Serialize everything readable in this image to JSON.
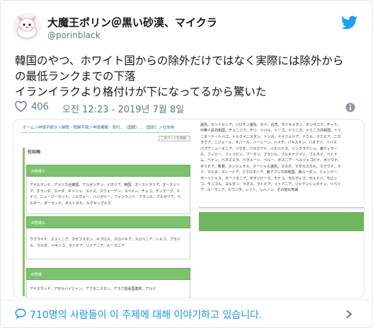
{
  "tweet": {
    "display_name": "大魔王ポリン＠黒い砂漠、マイクラ",
    "handle": "@porinblack",
    "text_lines": [
      "韓国のやつ、ホワイト国からの除外だけではなく実際には除外から",
      "の最低ランクまでの下落",
      "イランイラクより格付けが下になってるから驚いた"
    ],
    "like_count": "406",
    "timestamp": "오전 12:23 - 2019년 7월 8일",
    "footer_text": "710명의 사람들이 이 주제에 대해 이야기하고 있습니다."
  },
  "icons": {
    "platform": "twitter-bird-icon",
    "like": "heart-icon",
    "info": "info-icon",
    "footer": "speech-bubble-icon",
    "more": "chevron-right-icon"
  },
  "colors": {
    "brand_blue": "#1da1f2",
    "link_blue": "#1b95e0",
    "secondary_text": "#657786",
    "section_green": "#7ec26f"
  },
  "screenshot": {
    "breadcrumb": "ホーム＞申請手続き＞関税・税関手続＞申請書類・添付…（国籍）…（国別）＞仕向地",
    "print_label": "このページを印刷",
    "section_title": "仕向地",
    "groups": [
      {
        "title": "A地域①",
        "body": "アイルランド、アメリカ合衆国、アルゼンチン、イタリア、英国、オーストラリア、オーストリア、オランダ、カナダ、ギリシャ、スイス、スウェーデン、スペイン、チェコ、デンマーク、ドイツ、ニュージーランド、ノルウェー、ハンガリー、フィンランド、フランス、ブルガリア、ベルギー、ポーランド、ポルトガル、ルクセンブルク"
      },
      {
        "title": "A地域②",
        "body": "ウクライナ、エストニア、カザフスタン、キプロス、スロバキア、スロベニア、トルコ、ブラジル、マルタ、メキシコ、ラトビア、リトアニア、ルーマニア"
      },
      {
        "title": "B地域",
        "body": "アイスランド、アゼルバイジャン、アフガニスタン、アラブ首長国連邦、アルジ"
      }
    ],
    "right_text": "諸島、セントルシア、ソロモン諸島、タイ、台湾、タジキスタン、タンザニア、チャド、中華人民共和国、チュニジア、チリ、ツバル、トーゴ、ドミニカ、ドミニカ共和国、トリニダード・トバゴ、トルクメニスタン、トンガ、ナイジェリア、ナウル、ナミビア、ニカラグア、ニジェール、ネパール、バーレーン、ハイチ、パキスタン、バヌアツ、バハマ、パプアニューギニア、パラオ、パラグアイ、バルバドス、バングラデシュ、東ティモール、フィジー、フィリピン、ブータン、ブラジル、ブルキナファソ、ブルネイ、ベトナム、ベナン、ベネズエラ、ベラルーシ、ペルー、ボスニア・ヘルツェゴビナ、ボツワナ、ボリビア、香港、ホンジュラス、マーシャル諸島、マカオ、マダガスカル、マラウイ、マリ、マルタ、マレーシア、ミクロネシア、南アフリカ共和国、南スーダン、ミャンマー、モーリシャス、モーリタニア、モザンビーク、モナコ、モルディブ、モルドバ、モロッコ、モンゴル、ヨルダン、ラオス、ラトビア、リトアニア、リヒテンシュタイン、リベリア、ルーマニア、ルワンダ、レソト、レバノン、その他の地域"
  }
}
